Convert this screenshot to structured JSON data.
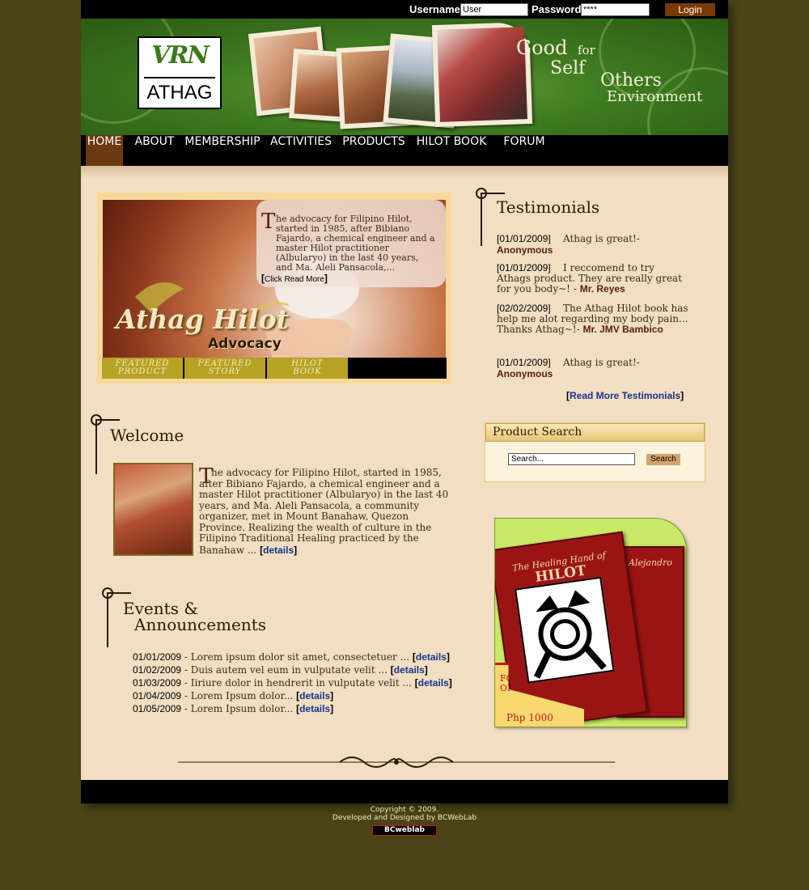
{
  "login": {
    "username_label": "Username:",
    "username_value": "User",
    "password_label": "Password:",
    "password_value": "****",
    "login_label": "Login"
  },
  "header": {
    "logo_mark": "VRN",
    "logo_text": "ATHAG",
    "tagline": [
      "Good",
      "for",
      "Self",
      "Others",
      "Environment"
    ]
  },
  "nav": [
    {
      "label": "HOME",
      "active": true
    },
    {
      "label": "ABOUT"
    },
    {
      "label": "MEMBERSHIP"
    },
    {
      "label": "ACTIVITIES"
    },
    {
      "label": "PRODUCTS"
    },
    {
      "label": "HILOT BOOK"
    },
    {
      "label": "FORUM"
    }
  ],
  "feature": {
    "drop_cap": "T",
    "caption": "he advocacy for Filipino Hilot, started in 1985, after Bibiano Fajardo, a chemical engineer and a master Hilot practitioner (Albularyo) in the last 40 years, and Ma. Aleli Pansacola,...",
    "read_more": "Click Read More",
    "title": "Athag Hilot",
    "subtitle": "Advocacy",
    "tabs": [
      {
        "line1": "FEATURED",
        "line2": "PRODUCT"
      },
      {
        "line1": "FEATURED",
        "line2": "STORY"
      },
      {
        "line1": "HILOT",
        "line2": "BOOK"
      }
    ]
  },
  "welcome": {
    "heading": "Welcome",
    "drop_cap": "T",
    "text": "he advocacy for Filipino Hilot, started in 1985, after Bibiano Fajardo, a chemical engineer and a master Hilot practitioner (Albularyo) in the last 40 years, and Ma. Aleli Pansacola, a community organizer, met in Mount Banahaw, Quezon Province.  Realizing the wealth of culture in the Filipino Traditional Healing practiced by the Banahaw ...",
    "details": "details"
  },
  "events": {
    "heading_line1": "Events &",
    "heading_line2": "Announcements",
    "items": [
      {
        "date": "01/01/2009",
        "text": " - Lorem ipsum dolor sit amet, consectetuer ... ",
        "link": "details"
      },
      {
        "date": "01/02/2009",
        "text": " - Duis autem vel eum in vulputate velit ... ",
        "link": "details"
      },
      {
        "date": "01/03/2009",
        "text": " - Iiriure dolor in hendrerit in vulputate velit ... ",
        "link": "details"
      },
      {
        "date": "01/04/2009",
        "text": " - Lorem Ipsum dolor... ",
        "link": "details"
      },
      {
        "date": "01/05/2009",
        "text": " - Lorem Ipsum dolor... ",
        "link": "details"
      }
    ]
  },
  "testimonials": {
    "heading": "Testimonials",
    "items": [
      {
        "date": "[01/01/2009]",
        "text": "Athag is great!- ",
        "author": "Anonymous"
      },
      {
        "date": "[01/01/2009]",
        "text": "I reccomend to try Athags product. They are really great for you body~! - ",
        "author": "Mr. Reyes"
      },
      {
        "date": "[02/02/2009]",
        "text": "The Athag Hilot book has help me alot regarding my body pain... Thanks Athag~!- ",
        "author": "Mr. JMV Bambico"
      },
      {
        "date": "[01/01/2009]",
        "text": "Athag is great!- ",
        "author": "Anonymous"
      }
    ],
    "read_more": "Read More Testimonials"
  },
  "product_search": {
    "heading": "Product Search",
    "input_value": "Search...",
    "button_label": "Search"
  },
  "promo": {
    "book_title_line1": "The Healing Hand of",
    "book_title_line2": "HILOT",
    "back_title": "Alejandro",
    "price_line1": "FOR",
    "price_line2": "ONLY",
    "price": "Php 1000"
  },
  "footer": {
    "copyright": "Copyright © 2009.",
    "credit": "Developed and Designed by BCWebLab",
    "badge": "BCweblab"
  },
  "colors": {
    "background": "#4a4418",
    "content": "#f2dec2",
    "nav_active": "#6b3a10",
    "header_green": "#3f7a20",
    "link": "#15338e",
    "author": "#5a1c0c"
  }
}
